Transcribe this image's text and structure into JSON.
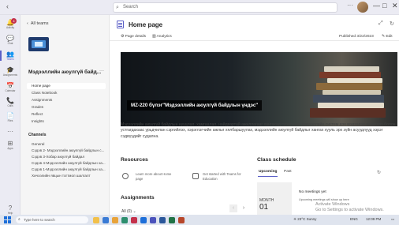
{
  "titlebar": {
    "search_placeholder": "Search",
    "more_label": "···",
    "window_controls": {
      "minimize": "—",
      "maximize": "□",
      "close": "✕"
    }
  },
  "rail": {
    "items": [
      {
        "label": "Activity",
        "icon": "bell-icon",
        "glyph": "🔔",
        "badge": "4"
      },
      {
        "label": "Chat",
        "icon": "chat-icon",
        "glyph": "💬"
      },
      {
        "label": "Teams",
        "icon": "teams-icon",
        "glyph": "👥",
        "active": true
      },
      {
        "label": "Assignments",
        "icon": "assignments-icon",
        "glyph": "🎓"
      },
      {
        "label": "Calendar",
        "icon": "calendar-icon",
        "glyph": "📅"
      },
      {
        "label": "Calls",
        "icon": "phone-icon",
        "glyph": "📞"
      },
      {
        "label": "Files",
        "icon": "file-icon",
        "glyph": "📄"
      },
      {
        "label": "",
        "icon": "more-icon",
        "glyph": "···"
      },
      {
        "label": "Apps",
        "icon": "apps-icon",
        "glyph": "⊞"
      },
      {
        "label": "Help",
        "icon": "help-icon",
        "glyph": "?"
      }
    ]
  },
  "teamnav": {
    "back_label": "All teams",
    "team_name": "Мэдээллийн аюулгүй байд...",
    "team_more": "···",
    "items": [
      "Home page",
      "Class Notebook",
      "Assignments",
      "Grades",
      "Reflect",
      "Insights"
    ],
    "channels_title": "Channels",
    "channels": [
      "General",
      "Сэдэв 2- Мэдээллийн аюулгүй байдлын с...",
      "Сэдэв 3-Хобар аюулгүй байдал",
      "Сэдэв 4-Мэдээллийн аюулгүй байдлын ха...",
      "Сэдэв 1-Мэдээллийн аюулгүй байдлын ха...",
      "Хичээлийн явцын тогтмол шалгалт"
    ]
  },
  "page": {
    "title": "Home page",
    "tabs": [
      "Page details",
      "Analytics"
    ],
    "published": "Published 3/22/2023",
    "edit_label": "Edit",
    "banner_caption": "MZ-220 бүлэг\"Мэдээллийн аюулгүй байдлын үндэс\"",
    "intro": "Мэдээллийн аюулгүй байдлын нууцлал, хамгаалал, найдвартай ажиллагааг хангахад суралцаж, мэдээллийн систем дэх мэдээлэл алдагдах болон устгагдахаас урьдчилан сэргийлэх, хэрэглэгчийн ажлыг хялбаршуулах, мэдээллийн аюулгүй байдлыг хангах хууль эрх зүйн асуудлууд хэрэг сэдвүүдийг судална.",
    "resources": {
      "title": "Resources",
      "items": [
        {
          "icon": "info-icon",
          "label": "Learn more about Home page"
        },
        {
          "icon": "chat-icon",
          "label": "Get started with Teams for Education"
        }
      ]
    },
    "schedule": {
      "title": "Class schedule",
      "tabs": [
        "Upcoming",
        "Past"
      ],
      "month": "MONTH",
      "day": "01",
      "no_meetings": "No meetings yet",
      "sub": "Upcoming meetings will show up here"
    },
    "assignments": {
      "title": "Assignments",
      "filter": "All (0) ⌄"
    },
    "watermark": [
      "Activate Windows",
      "Go to Settings to activate Windows."
    ]
  },
  "taskbar": {
    "search_placeholder": "Type here to search",
    "weather": "23°C Sunny",
    "time": "12:09 PM",
    "language": "ENG"
  },
  "colors": {
    "accent": "#5b5fc7",
    "rail_bg": "#ebebf3",
    "badge": "#c4314b"
  }
}
